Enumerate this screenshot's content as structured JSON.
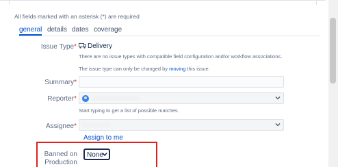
{
  "notice": "All fields marked with an asterisk (*) are required",
  "tabs": [
    {
      "label": "general",
      "active": true
    },
    {
      "label": "details",
      "active": false
    },
    {
      "label": "dates",
      "active": false
    },
    {
      "label": "coverage",
      "active": false
    }
  ],
  "issue_type": {
    "label": "Issue Type",
    "required_mark": "*",
    "value": "Delivery",
    "icon": "delivery-icon",
    "note1": "There are no issue types with compatible field configuration and/or workflow associations.",
    "note2_prefix": "The issue type can only be changed by ",
    "note2_link": "moving",
    "note2_suffix": " this issue."
  },
  "summary": {
    "label": "Summary",
    "required_mark": "*"
  },
  "reporter": {
    "label": "Reporter",
    "required_mark": "*",
    "hint": "Start typing to get a list of possible matches."
  },
  "assignee": {
    "label": "Assignee",
    "required_mark": "*",
    "assign_link": "Assign to me"
  },
  "banned": {
    "label_line1": "Banned on",
    "label_line2": "Production",
    "value": "None"
  },
  "colors": {
    "link": "#0052cc",
    "required": "#de350b",
    "highlight": "#e01e1e"
  }
}
